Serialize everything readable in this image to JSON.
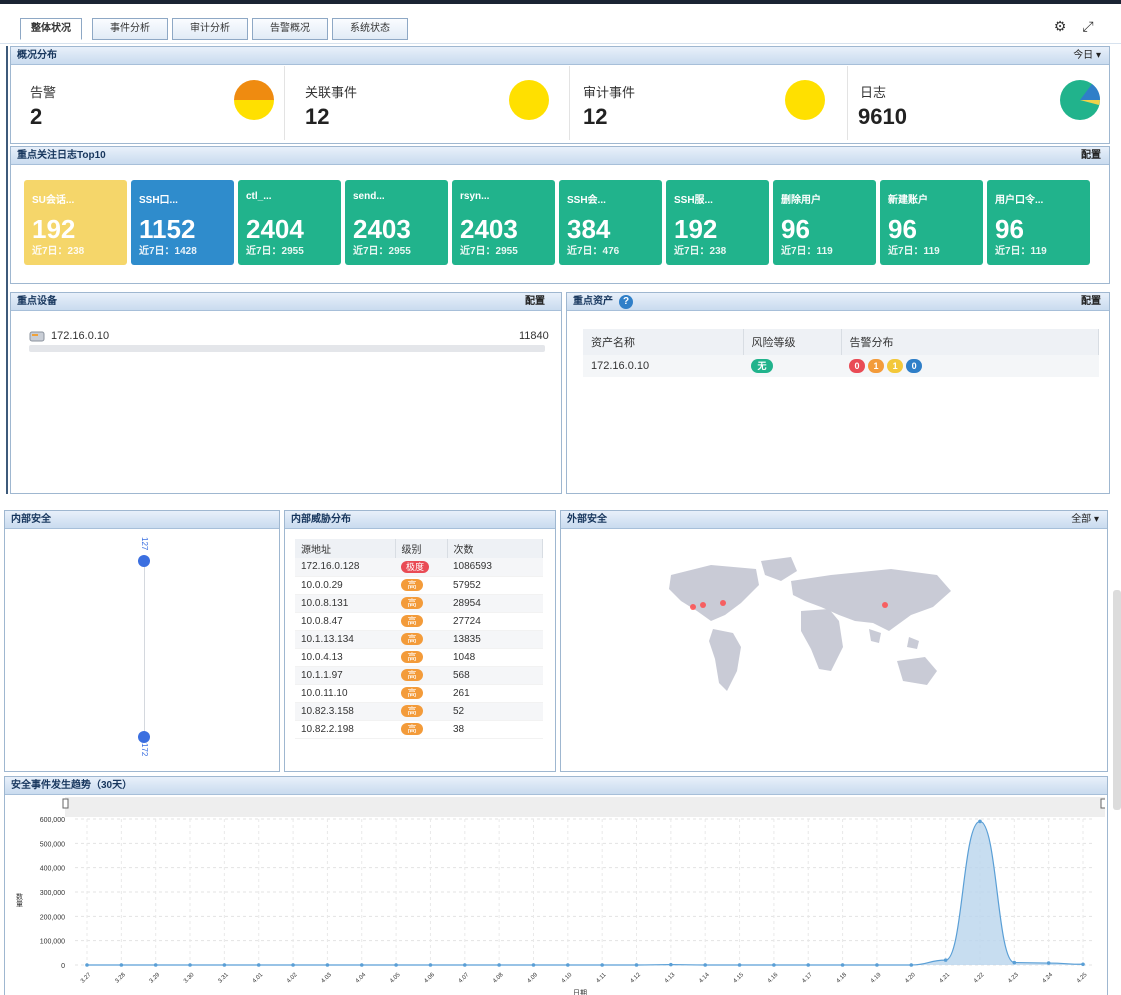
{
  "tabs": [
    "整体状况",
    "事件分析",
    "审计分析",
    "告警概况",
    "系统状态"
  ],
  "toolbar": {
    "settings_icon": "gear-icon",
    "expand_icon": "expand-icon"
  },
  "overview": {
    "title": "概况分布",
    "range": "今日 ▾",
    "stats": [
      {
        "label": "告警",
        "value": "2"
      },
      {
        "label": "关联事件",
        "value": "12"
      },
      {
        "label": "审计事件",
        "value": "12"
      },
      {
        "label": "日志",
        "value": "9610"
      }
    ]
  },
  "top10": {
    "title": "重点关注日志Top10",
    "config": "配置",
    "tiles": [
      {
        "name": "SU会话...",
        "value": "192",
        "sub": "近7日：238",
        "color": "#f5d66a"
      },
      {
        "name": "SSH口...",
        "value": "1152",
        "sub": "近7日：1428",
        "color": "#2f8ccc"
      },
      {
        "name": "ctl_...",
        "value": "2404",
        "sub": "近7日：2955",
        "color": "#21b38c"
      },
      {
        "name": "send...",
        "value": "2403",
        "sub": "近7日：2955",
        "color": "#21b38c"
      },
      {
        "name": "rsyn...",
        "value": "2403",
        "sub": "近7日：2955",
        "color": "#21b38c"
      },
      {
        "name": "SSH会...",
        "value": "384",
        "sub": "近7日：476",
        "color": "#21b38c"
      },
      {
        "name": "SSH服...",
        "value": "192",
        "sub": "近7日：238",
        "color": "#21b38c"
      },
      {
        "name": "删除用户",
        "value": "96",
        "sub": "近7日：119",
        "color": "#21b38c"
      },
      {
        "name": "新建账户",
        "value": "96",
        "sub": "近7日：119",
        "color": "#21b38c"
      },
      {
        "name": "用户口令...",
        "value": "96",
        "sub": "近7日：119",
        "color": "#21b38c"
      }
    ]
  },
  "devices": {
    "title": "重点设备",
    "config": "配置",
    "rows": [
      {
        "ip": "172.16.0.10",
        "count": "11840"
      }
    ]
  },
  "assets": {
    "title": "重点资产",
    "config": "配置",
    "columns": [
      "资产名称",
      "风险等级",
      "告警分布"
    ],
    "rows": [
      {
        "name": "172.16.0.10",
        "risk": "无",
        "alerts": [
          "0",
          "1",
          "1",
          "0"
        ]
      }
    ]
  },
  "internal": {
    "title": "内部安全",
    "top_label": "127",
    "bottom_label": "172"
  },
  "threats": {
    "title": "内部威胁分布",
    "columns": [
      "源地址",
      "级别",
      "次数"
    ],
    "rows": [
      {
        "ip": "172.16.0.128",
        "level": "极度",
        "count": "1086593"
      },
      {
        "ip": "10.0.0.29",
        "level": "高",
        "count": "57952"
      },
      {
        "ip": "10.0.8.131",
        "level": "高",
        "count": "28954"
      },
      {
        "ip": "10.0.8.47",
        "level": "高",
        "count": "27724"
      },
      {
        "ip": "10.1.13.134",
        "level": "高",
        "count": "13835"
      },
      {
        "ip": "10.0.4.13",
        "level": "高",
        "count": "1048"
      },
      {
        "ip": "10.1.1.97",
        "level": "高",
        "count": "568"
      },
      {
        "ip": "10.0.11.10",
        "level": "高",
        "count": "261"
      },
      {
        "ip": "10.82.3.158",
        "level": "高",
        "count": "52"
      },
      {
        "ip": "10.82.2.198",
        "level": "高",
        "count": "38"
      }
    ]
  },
  "external": {
    "title": "外部安全",
    "filter": "全部 ▾"
  },
  "trend": {
    "title": "安全事件发生趋势（30天）"
  },
  "chart_data": {
    "type": "area",
    "title": "",
    "xlabel": "日期",
    "ylabel": "数量",
    "ylim": [
      0,
      600000
    ],
    "yticks": [
      "0",
      "100,000",
      "200,000",
      "300,000",
      "400,000",
      "500,000",
      "600,000"
    ],
    "categories": [
      "3.27",
      "3.28",
      "3.29",
      "3.30",
      "3.31",
      "4.01",
      "4.02",
      "4.03",
      "4.04",
      "4.05",
      "4.06",
      "4.07",
      "4.08",
      "4.09",
      "4.10",
      "4.11",
      "4.12",
      "4.13",
      "4.14",
      "4.15",
      "4.16",
      "4.17",
      "4.18",
      "4.19",
      "4.20",
      "4.21",
      "4.22",
      "4.23",
      "4.24",
      "4.25"
    ],
    "series": [
      {
        "values": [
          0,
          0,
          0,
          0,
          0,
          0,
          0,
          0,
          0,
          0,
          0,
          0,
          0,
          0,
          0,
          0,
          0,
          1500,
          0,
          0,
          0,
          0,
          0,
          0,
          0,
          20000,
          590000,
          10000,
          8000,
          3000
        ]
      }
    ]
  }
}
